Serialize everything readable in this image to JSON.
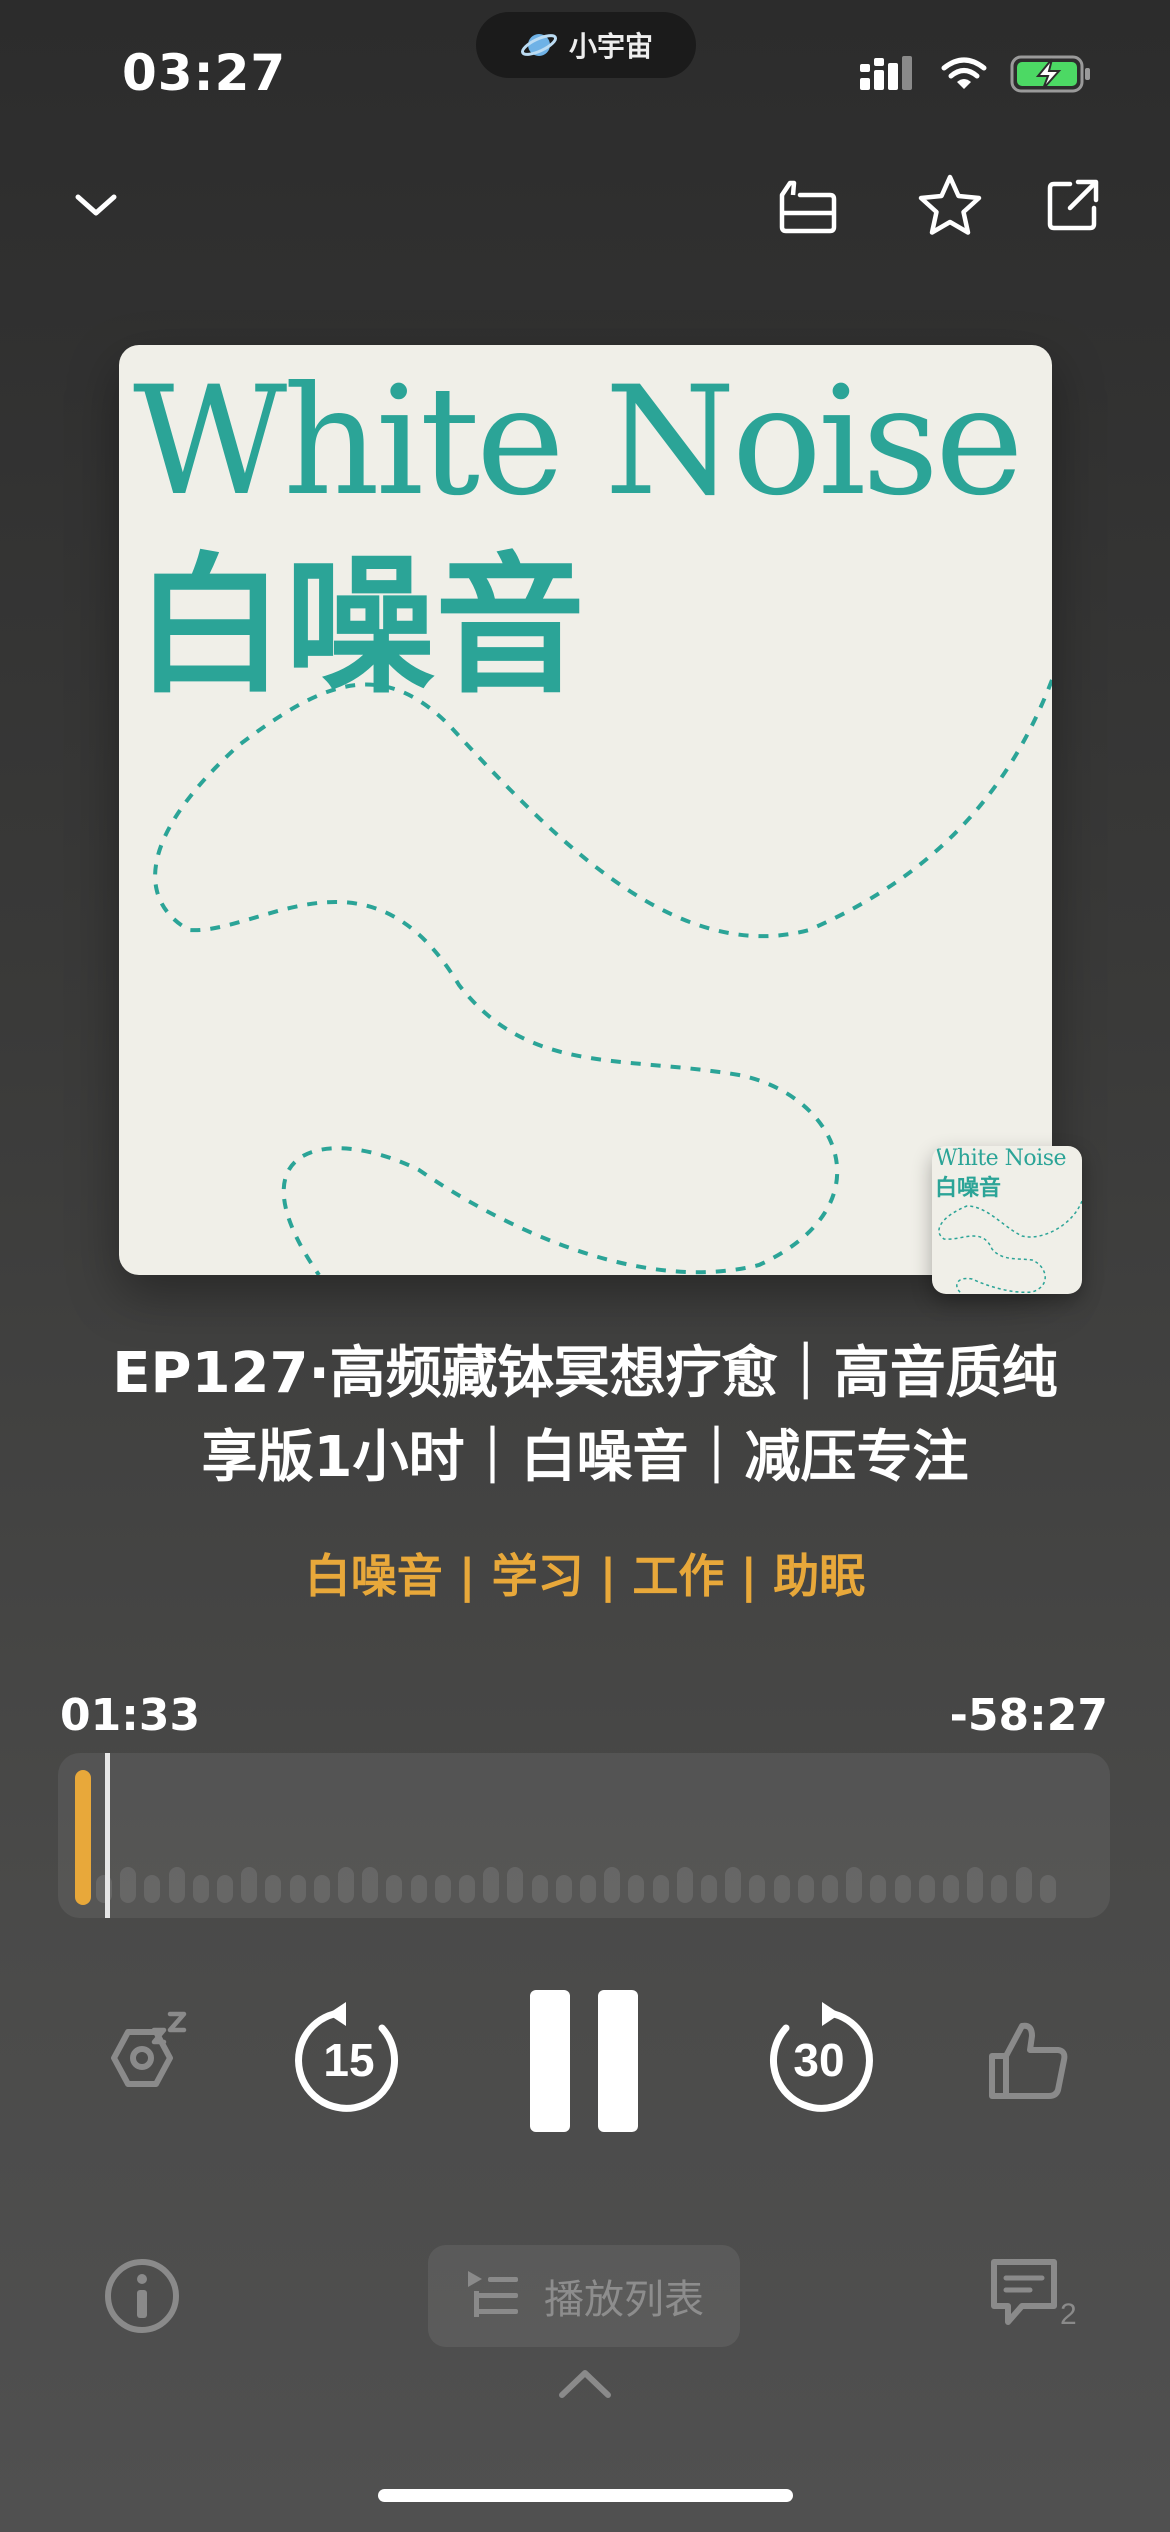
{
  "status_bar": {
    "time": "03:27",
    "island_label": "小宇宙",
    "icons": [
      "planet-icon",
      "signal-icon",
      "wifi-icon",
      "battery-charging-icon"
    ]
  },
  "toolbar": {
    "icons": [
      "chevron-down-icon",
      "sleep-timer-card-icon",
      "star-icon",
      "share-icon"
    ]
  },
  "cover": {
    "title_en": "White Noise",
    "title_zh": "白噪音"
  },
  "episode": {
    "title_line1": "EP127·高频藏钵冥想疗愈｜高音质纯",
    "title_line2": "享版1小时｜白噪音｜减压专注",
    "tags": "白噪音 | 学习 | 工作 | 助眠"
  },
  "progress": {
    "elapsed": "01:33",
    "remaining": "-58:27",
    "fraction": 0.026
  },
  "controls": {
    "icons": [
      "sleep-timer-icon",
      "rewind-15-icon",
      "pause-icon",
      "forward-30-icon",
      "like-icon"
    ],
    "rewind_seconds": "15",
    "forward_seconds": "30"
  },
  "bottom": {
    "playlist_label": "播放列表",
    "comment_count": "2",
    "icons": [
      "info-icon",
      "playlist-icon",
      "comment-icon",
      "chevron-up-icon"
    ]
  },
  "colors": {
    "accent": "#e8a83a",
    "cover_teal": "#2ba497",
    "cover_bg": "#f0efe8"
  }
}
